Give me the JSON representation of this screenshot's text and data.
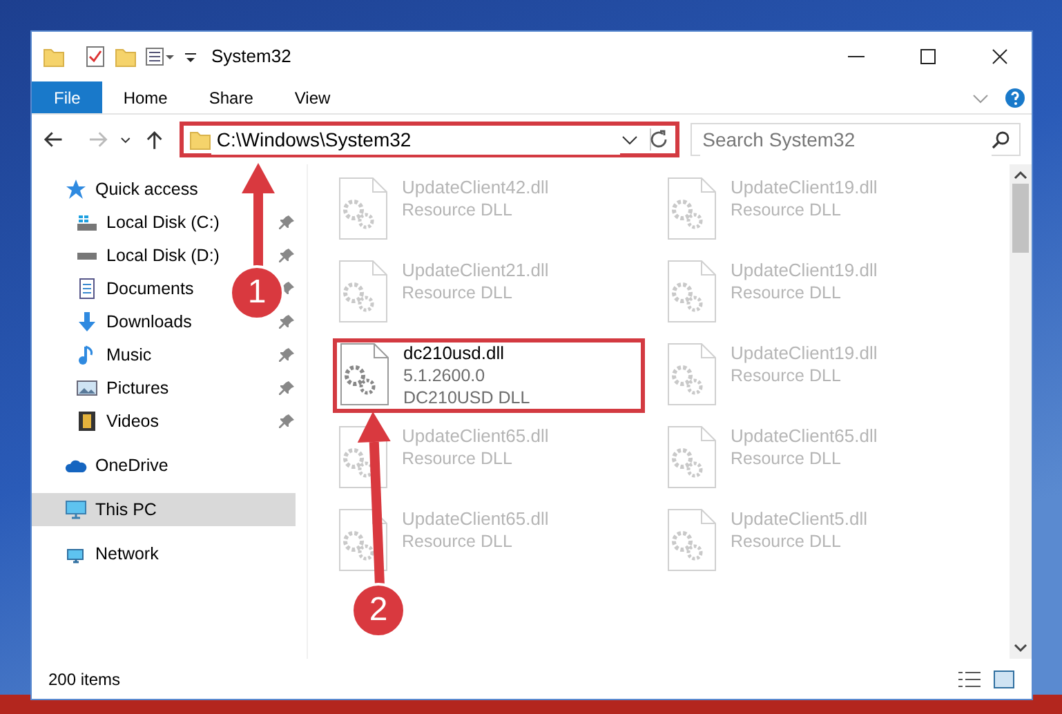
{
  "window": {
    "title": "System32"
  },
  "ribbon_tabs": [
    {
      "label": "File",
      "selected": true
    },
    {
      "label": "Home",
      "selected": false
    },
    {
      "label": "Share",
      "selected": false
    },
    {
      "label": "View",
      "selected": false
    }
  ],
  "address_bar": {
    "path": "C:\\Windows\\System32"
  },
  "search": {
    "placeholder": "Search System32"
  },
  "nav_pane": [
    {
      "label": "Quick access",
      "kind": "star",
      "selected": false,
      "pinned": false,
      "children": [
        {
          "label": "Local Disk (C:)",
          "kind": "drive-c",
          "selected": false,
          "pinned": true
        },
        {
          "label": "Local Disk (D:)",
          "kind": "drive",
          "selected": false,
          "pinned": true
        },
        {
          "label": "Documents",
          "kind": "document",
          "selected": false,
          "pinned": true
        },
        {
          "label": "Downloads",
          "kind": "download",
          "selected": false,
          "pinned": true
        },
        {
          "label": "Music",
          "kind": "music",
          "selected": false,
          "pinned": true
        },
        {
          "label": "Pictures",
          "kind": "picture",
          "selected": false,
          "pinned": true
        },
        {
          "label": "Videos",
          "kind": "video",
          "selected": false,
          "pinned": true
        }
      ]
    },
    {
      "label": "OneDrive",
      "kind": "cloud",
      "selected": false,
      "pinned": false
    },
    {
      "label": "This PC",
      "kind": "computer",
      "selected": true,
      "pinned": false
    },
    {
      "label": "Network",
      "kind": "network",
      "selected": false,
      "pinned": false
    }
  ],
  "files": [
    {
      "name": "UpdateClient42.dll",
      "line_2": "Resource DLL",
      "blurred": true,
      "highlighted": false
    },
    {
      "name": "UpdateClient19.dll",
      "line_2": "Resource DLL",
      "blurred": true,
      "highlighted": false
    },
    {
      "name": "UpdateClient21.dll",
      "line_2": "Resource DLL",
      "blurred": true,
      "highlighted": false
    },
    {
      "name": "UpdateClient19.dll",
      "line_2": "Resource DLL",
      "blurred": true,
      "highlighted": false
    },
    {
      "name": "dc210usd.dll",
      "line_2": "5.1.2600.0",
      "line_3": "DC210USD DLL",
      "blurred": false,
      "highlighted": true
    },
    {
      "name": "UpdateClient19.dll",
      "line_2": "Resource DLL",
      "blurred": true,
      "highlighted": false
    },
    {
      "name": "UpdateClient65.dll",
      "line_2": "Resource DLL",
      "blurred": true,
      "highlighted": false
    },
    {
      "name": "UpdateClient65.dll",
      "line_2": "Resource DLL",
      "blurred": true,
      "highlighted": false
    },
    {
      "name": "UpdateClient65.dll",
      "line_2": "Resource DLL",
      "blurred": true,
      "highlighted": false
    },
    {
      "name": "UpdateClient5.dll",
      "line_2": "Resource DLL",
      "blurred": true,
      "highlighted": false
    }
  ],
  "status_bar": {
    "item_count": "200 items"
  },
  "annotations": [
    {
      "label": "1"
    },
    {
      "label": "2"
    }
  ]
}
